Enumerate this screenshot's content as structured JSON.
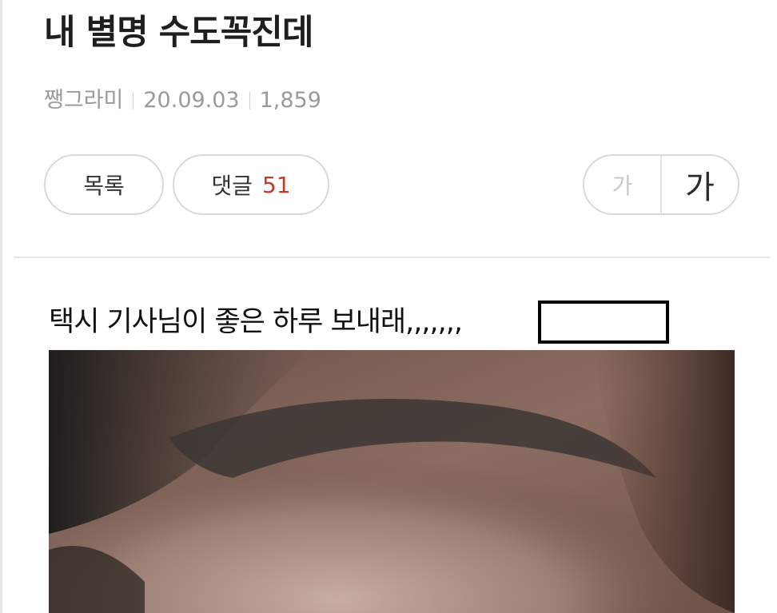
{
  "post": {
    "title": "내 별명 수도꼭진데",
    "author": "쨍그라미",
    "date": "20.09.03",
    "views": "1,859",
    "body_text": "택시 기사님이 좋은 하루 보내래,,,,,,,"
  },
  "toolbar": {
    "list_label": "목록",
    "comment_label": "댓글",
    "comment_count": "51",
    "font_small_label": "가",
    "font_large_label": "가"
  },
  "colors": {
    "comment_count": "#c0392b",
    "meta_text": "#9a9a9a",
    "border": "#d9d9d9"
  },
  "image": {
    "description_icon": "photo-of-face-closeup"
  }
}
